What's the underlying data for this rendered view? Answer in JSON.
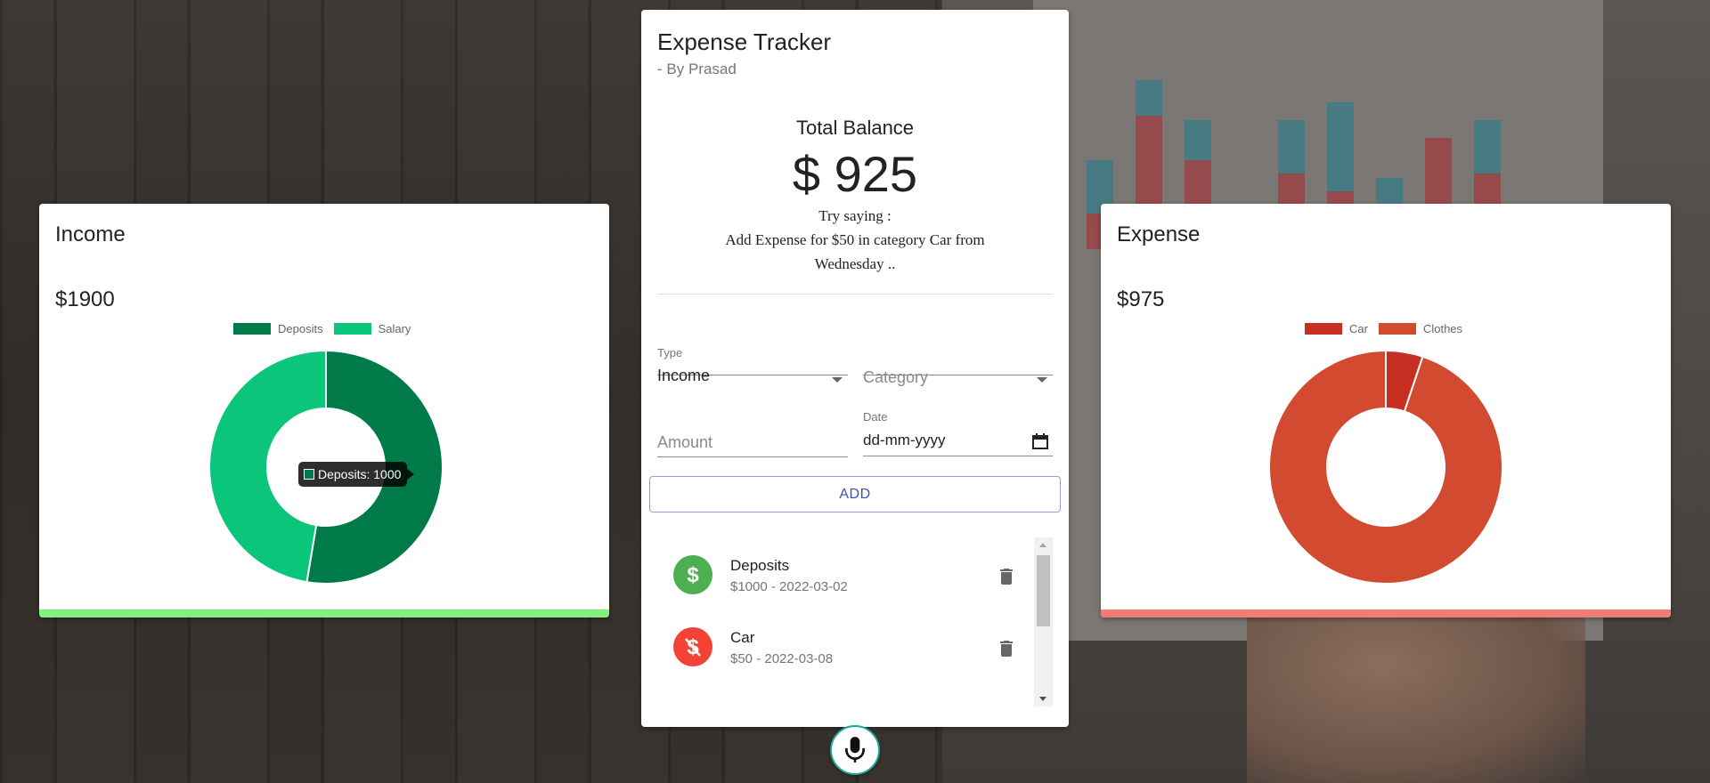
{
  "tracker": {
    "title": "Expense Tracker",
    "subtitle": "- By Prasad",
    "balance_label": "Total Balance",
    "balance_value": "$ 925",
    "hint_line1": "Try saying :",
    "hint_line2": "Add Expense for $50 in category Car from Wednesday ..",
    "form": {
      "type_label": "Type",
      "type_value": "Income",
      "category_placeholder": "Category",
      "amount_placeholder": "Amount",
      "date_label": "Date",
      "date_placeholder": "dd-mm-yyyy",
      "add_label": "ADD"
    },
    "transactions": [
      {
        "name": "Deposits",
        "detail": "$1000 - 2022-03-02",
        "kind": "income",
        "icon": "dollar-icon",
        "color": "#4caf50"
      },
      {
        "name": "Car",
        "detail": "$50 - 2022-03-08",
        "kind": "expense",
        "icon": "money-off-icon",
        "color": "#f44336"
      }
    ]
  },
  "income": {
    "title": "Income",
    "total": "$1900",
    "accent": "#7ef27a",
    "tooltip": "Deposits: 1000"
  },
  "expense": {
    "title": "Expense",
    "total": "$975",
    "accent": "#f27c74"
  },
  "chart_data": [
    {
      "type": "pie",
      "donut": true,
      "categories": [
        "Deposits",
        "Salary"
      ],
      "values": [
        1000,
        900
      ],
      "colors": [
        "#007a48",
        "#0bc57a"
      ],
      "legend": "top"
    },
    {
      "type": "pie",
      "donut": true,
      "categories": [
        "Car",
        "Clothes"
      ],
      "values": [
        50,
        925
      ],
      "colors": [
        "#c62f22",
        "#d24a30"
      ],
      "legend": "top"
    }
  ]
}
